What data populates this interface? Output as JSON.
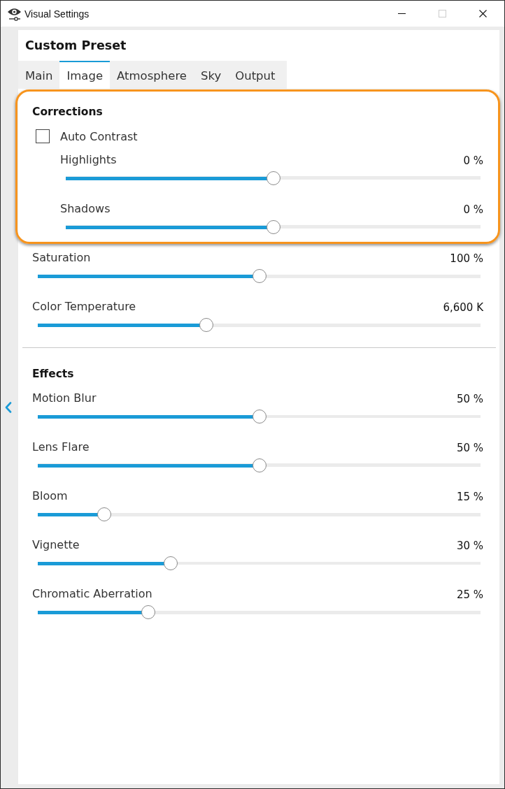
{
  "window": {
    "title": "Visual Settings",
    "buttons": [
      {
        "kind": "minimize",
        "disabled": false
      },
      {
        "kind": "maximize",
        "disabled": true
      },
      {
        "kind": "close",
        "disabled": false
      }
    ]
  },
  "preset": {
    "title": "Custom Preset"
  },
  "tabs": [
    {
      "label": "Main",
      "selected": false
    },
    {
      "label": "Image",
      "selected": true
    },
    {
      "label": "Atmosphere",
      "selected": false
    },
    {
      "label": "Sky",
      "selected": false
    },
    {
      "label": "Output",
      "selected": false
    }
  ],
  "sections": [
    {
      "title": "Corrections",
      "items": [
        {
          "kind": "checkbox",
          "label": "Auto Contrast",
          "checked": false,
          "highlighted": true,
          "children": [
            {
              "kind": "slider",
              "label": "Highlights",
              "reading": "0 %",
              "level": 0.5
            },
            {
              "kind": "slider",
              "label": "Shadows",
              "reading": "0 %",
              "level": 0.5
            }
          ]
        },
        {
          "kind": "slider",
          "label": "Saturation",
          "reading": "100 %",
          "level": 0.5,
          "highlighted": false
        },
        {
          "kind": "slider",
          "label": "Color Temperature",
          "reading": "6,600 K",
          "level": 0.38,
          "highlighted": false
        }
      ]
    },
    {
      "title": "Effects",
      "items": [
        {
          "kind": "slider",
          "label": "Motion Blur",
          "reading": "50 %",
          "level": 0.5,
          "highlighted": false
        },
        {
          "kind": "slider",
          "label": "Lens Flare",
          "reading": "50 %",
          "level": 0.5,
          "highlighted": false
        },
        {
          "kind": "slider",
          "label": "Bloom",
          "reading": "15 %",
          "level": 0.15,
          "highlighted": false
        },
        {
          "kind": "slider",
          "label": "Vignette",
          "reading": "30 %",
          "level": 0.3,
          "highlighted": false
        },
        {
          "kind": "slider",
          "label": "Chromatic Aberration",
          "reading": "25 %",
          "level": 0.25,
          "highlighted": false
        }
      ]
    }
  ]
}
